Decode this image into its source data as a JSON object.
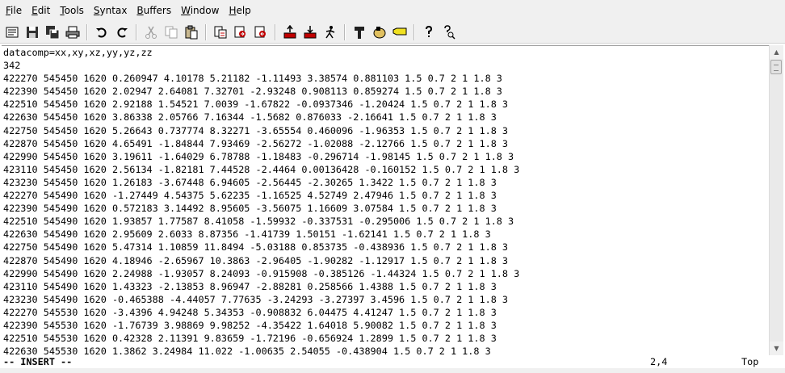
{
  "menu": {
    "items": [
      "File",
      "Edit",
      "Tools",
      "Syntax",
      "Buffers",
      "Window",
      "Help"
    ],
    "underline": [
      "F",
      "E",
      "T",
      "S",
      "B",
      "W",
      "H"
    ]
  },
  "toolbar": {
    "icons": [
      "open-icon",
      "save-icon",
      "save-all-icon",
      "print-icon",
      "undo-icon",
      "redo-icon",
      "cut-icon",
      "copy-icon",
      "paste-icon",
      "find-replace-icon",
      "find-next-icon",
      "find-prev-icon",
      "load-session-icon",
      "save-session-icon",
      "run-script-icon",
      "make-icon",
      "shell-icon",
      "ctags-icon",
      "help-icon",
      "find-help-icon"
    ]
  },
  "editor": {
    "lines": [
      "datacomp=xx,xy,xz,yy,yz,zz",
      "342",
      "422270 545450 1620 0.260947 4.10178 5.21182 -1.11493 3.38574 0.881103 1.5 0.7 2 1 1.8 3",
      "422390 545450 1620 2.02947 2.64081 7.32701 -2.93248 0.908113 0.859274 1.5 0.7 2 1 1.8 3",
      "422510 545450 1620 2.92188 1.54521 7.0039 -1.67822 -0.0937346 -1.20424 1.5 0.7 2 1 1.8 3",
      "422630 545450 1620 3.86338 2.05766 7.16344 -1.5682 0.876033 -2.16641 1.5 0.7 2 1 1.8 3",
      "422750 545450 1620 5.26643 0.737774 8.32271 -3.65554 0.460096 -1.96353 1.5 0.7 2 1 1.8 3",
      "422870 545450 1620 4.65491 -1.84844 7.93469 -2.56272 -1.02088 -2.12766 1.5 0.7 2 1 1.8 3",
      "422990 545450 1620 3.19611 -1.64029 6.78788 -1.18483 -0.296714 -1.98145 1.5 0.7 2 1 1.8 3",
      "423110 545450 1620 2.56134 -1.82181 7.44528 -2.4464 0.00136428 -0.160152 1.5 0.7 2 1 1.8 3",
      "423230 545450 1620 1.26183 -3.67448 6.94605 -2.56445 -2.30265 1.3422 1.5 0.7 2 1 1.8 3",
      "422270 545490 1620 -1.27449 4.54375 5.62235 -1.16525 4.52749 2.47946 1.5 0.7 2 1 1.8 3",
      "422390 545490 1620 0.572183 3.14492 8.95605 -3.56075 1.16609 3.07584 1.5 0.7 2 1 1.8 3",
      "422510 545490 1620 1.93857 1.77587 8.41058 -1.59932 -0.337531 -0.295006 1.5 0.7 2 1 1.8 3",
      "422630 545490 1620 2.95609 2.6033 8.87356 -1.41739 1.50151 -1.62141 1.5 0.7 2 1 1.8 3",
      "422750 545490 1620 5.47314 1.10859 11.8494 -5.03188 0.853735 -0.438936 1.5 0.7 2 1 1.8 3",
      "422870 545490 1620 4.18946 -2.65967 10.3863 -2.96405 -1.90282 -1.12917 1.5 0.7 2 1 1.8 3",
      "422990 545490 1620 2.24988 -1.93057 8.24093 -0.915908 -0.385126 -1.44324 1.5 0.7 2 1 1.8 3",
      "423110 545490 1620 1.43323 -2.13853 8.96947 -2.88281 0.258566 1.4388 1.5 0.7 2 1 1.8 3",
      "423230 545490 1620 -0.465388 -4.44057 7.77635 -3.24293 -3.27397 3.4596 1.5 0.7 2 1 1.8 3",
      "422270 545530 1620 -3.4396 4.94248 5.34353 -0.908832 6.04475 4.41247 1.5 0.7 2 1 1.8 3",
      "422390 545530 1620 -1.76739 3.98869 9.98252 -4.35422 1.64018 5.90082 1.5 0.7 2 1 1.8 3",
      "422510 545530 1620 0.42328 2.11391 9.83659 -1.72196 -0.656924 1.2899 1.5 0.7 2 1 1.8 3",
      "422630 545530 1620 1.3862 3.24984 11.022 -1.00635 2.54055 -0.438904 1.5 0.7 2 1 1.8 3"
    ]
  },
  "status": {
    "mode": "-- INSERT --",
    "position": "2,4",
    "scroll": "Top"
  }
}
